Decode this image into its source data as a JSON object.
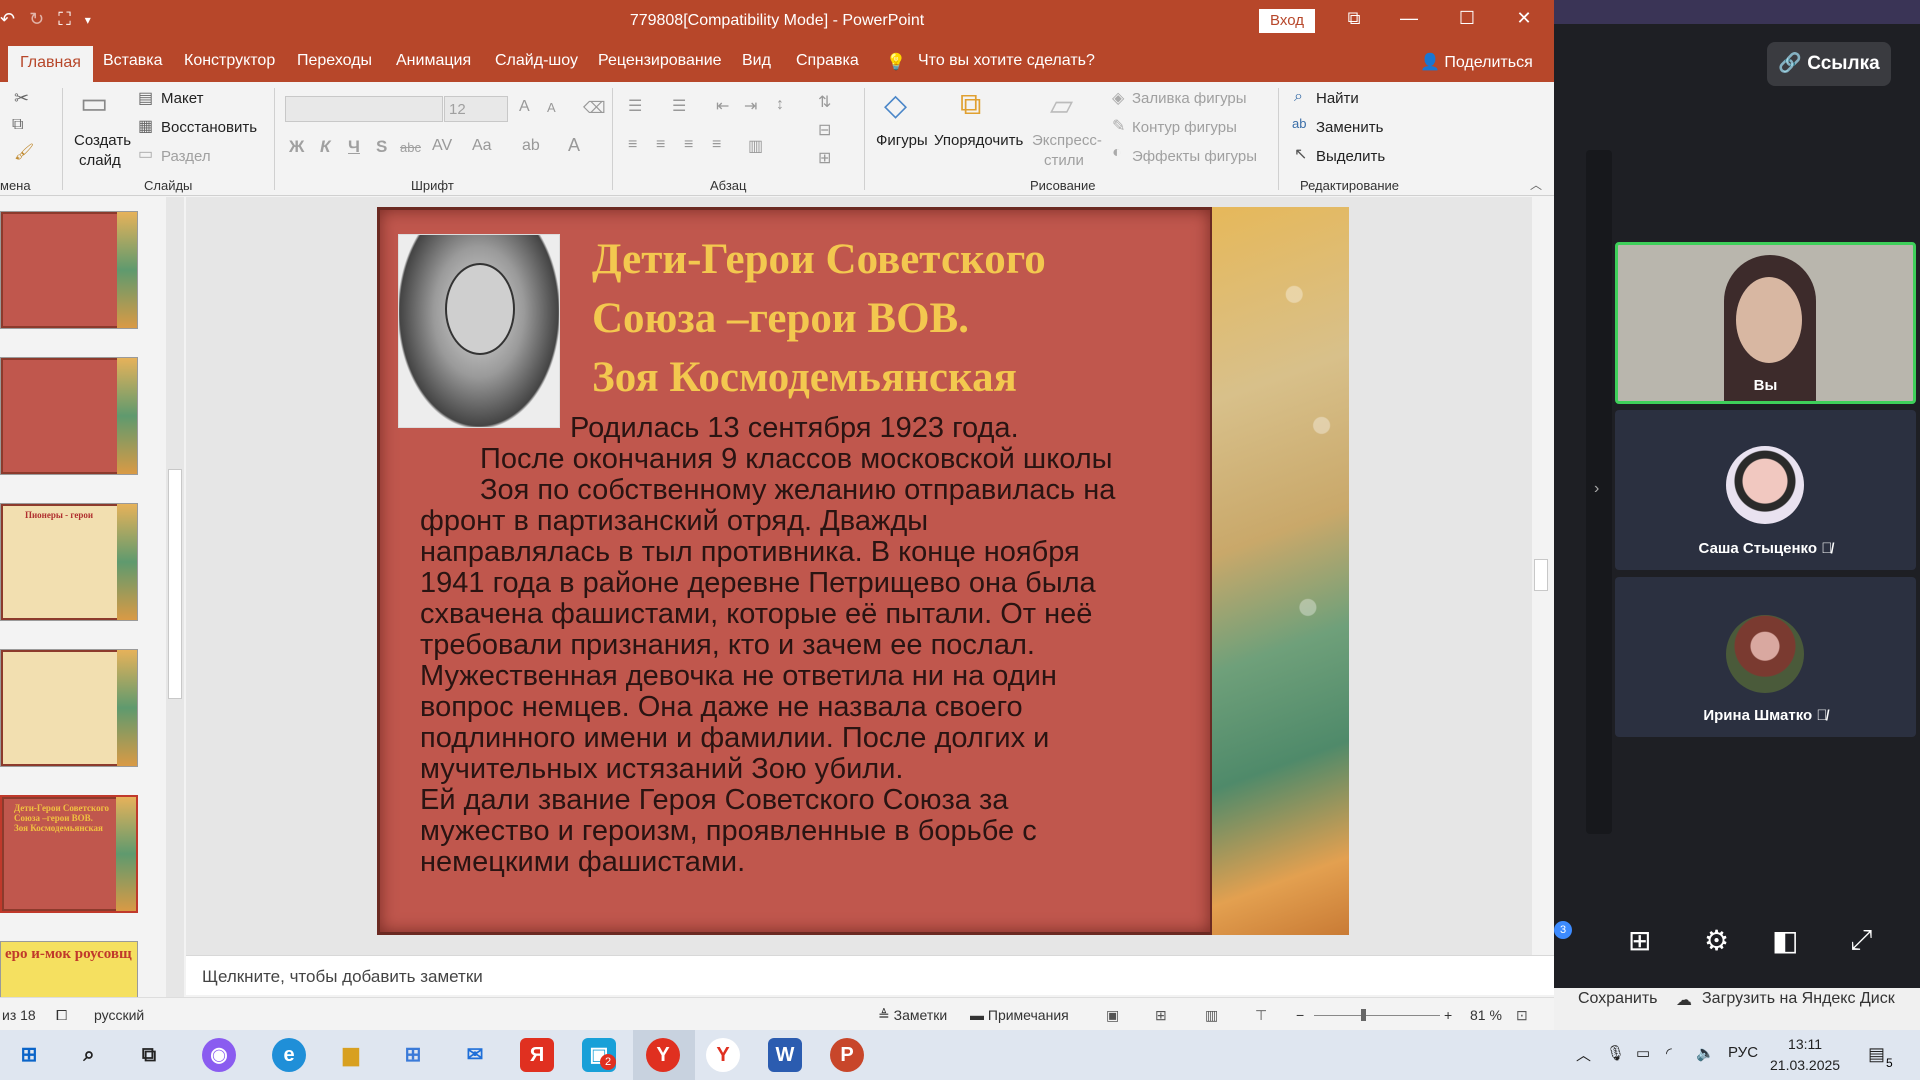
{
  "window": {
    "title": "779808[Compatibility Mode]  -  PowerPoint",
    "login_button": "Вход",
    "minimize_glyph": "—",
    "maximize_glyph": "☐",
    "close_glyph": "✕",
    "ribbon_display_glyph": "⧉"
  },
  "tabs": [
    "Главная",
    "Вставка",
    "Конструктор",
    "Переходы",
    "Анимация",
    "Слайд-шоу",
    "Рецензирование",
    "Вид",
    "Справка"
  ],
  "tell_me": "Что вы хотите сделать?",
  "share": "Поделиться",
  "ribbon": {
    "clipboard_label": "мена",
    "slides": {
      "new_slide": "Создать",
      "new_slide_2": "слайд",
      "layout": "Макет",
      "reset": "Восстановить",
      "section": "Раздел",
      "group_label": "Слайды"
    },
    "font": {
      "size": "12",
      "bold": "Ж",
      "italic": "К",
      "underline": "Ч",
      "shadow": "S",
      "strike": "abc",
      "group_label": "Шрифт"
    },
    "paragraph": {
      "group_label": "Абзац"
    },
    "drawing": {
      "shapes": "Фигуры",
      "arrange": "Упорядочить",
      "quick_styles": "Экспресс-",
      "quick_styles_2": "стили",
      "fill": "Заливка фигуры",
      "outline": "Контур фигуры",
      "effects": "Эффекты фигуры",
      "group_label": "Рисование"
    },
    "editing": {
      "find": "Найти",
      "replace": "Заменить",
      "select": "Выделить",
      "group_label": "Редактирование"
    }
  },
  "thumbnails": {
    "slide_4_title": "Пионеры - герои",
    "slide_6_title_lines": [
      "Дети-Герои  Советского",
      "Союза –герои ВОВ.",
      "Зоя Космодемьянская"
    ],
    "slide_7_title": "еро и-мок роусовщ"
  },
  "slide": {
    "title_lines": [
      "Дети-Герои  Советского",
      "Союза –герои ВОВ.",
      "Зоя Космодемьянская"
    ],
    "body_lines": [
      "        Родилась 13 сентября 1923 года.",
      "        После окончания 9 классов московской школы",
      "        Зоя по собственному желанию отправилась на",
      "фронт в партизанский отряд. Дважды",
      "направлялась в тыл противника. В конце ноября",
      "1941 года в районе деревне Петрищево она была",
      "схвачена фашистами, которые её пытали.  От неё",
      "требовали признания, кто и зачем ее послал.",
      "Мужественная девочка не ответила ни на один",
      "вопрос немцев. Она даже не назвала своего",
      "подлинного имени и фамилии. После долгих и",
      "мучительных истязаний Зою убили.",
      "Ей дали звание Героя Советского Союза  за",
      "мужество и героизм, проявленные в борьбе с",
      "немецкими фашистами."
    ]
  },
  "notes_placeholder": "Щелкните, чтобы добавить заметки",
  "status": {
    "slide_counter": "из 18",
    "language": "русский",
    "notes_button": "Заметки",
    "comments_button": "Примечания",
    "zoom": "81 %"
  },
  "meeting": {
    "link_button": "Ссылка",
    "participants": [
      {
        "name": "Вы"
      },
      {
        "name": "Саша Стыценко"
      },
      {
        "name": "Ирина Шматко"
      }
    ],
    "badge_count": "3",
    "save_label": "Сохранить",
    "yandex_disk_label": "Загрузить на Яндекс Диск"
  },
  "taskbar": {
    "language": "РУС",
    "time": "13:11",
    "date": "21.03.2025",
    "notifications": "5",
    "yandex_badge": "2"
  },
  "colors": {
    "ppt_accent": "#b7472a",
    "slide_title": "#f3c84f",
    "slide_bg": "#c0574d",
    "active_speaker": "#3ecf5a"
  }
}
